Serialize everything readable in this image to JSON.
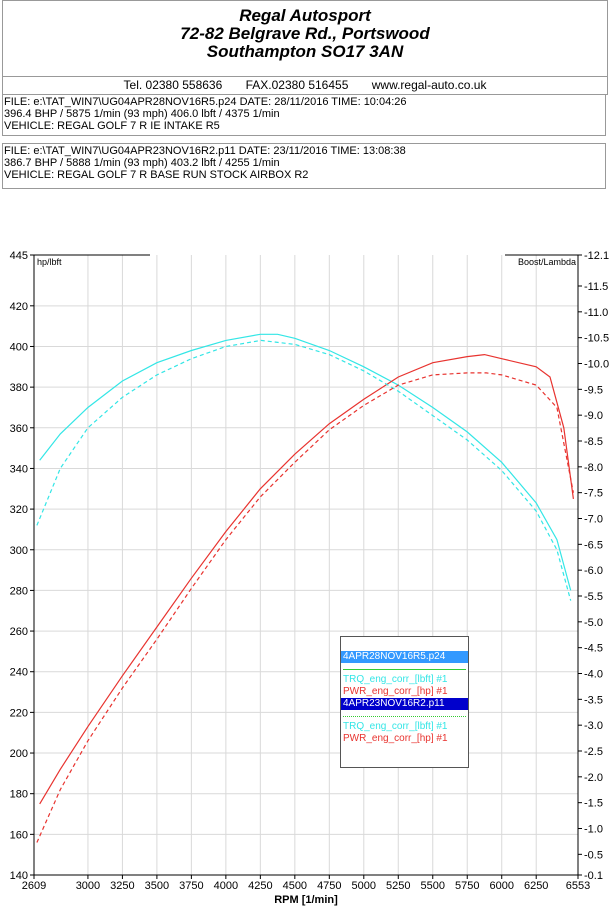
{
  "header": {
    "line1": "Regal Autosport",
    "line2": "72-82 Belgrave Rd., Portswood",
    "line3": "Southampton SO17 3AN",
    "tel": "Tel. 02380 558636",
    "fax": "FAX.02380 516455",
    "web": "www.regal-auto.co.uk"
  },
  "file1": {
    "line1": "FILE: e:\\TAT_WIN7\\UG04APR28NOV16R5.p24  DATE: 28/11/2016  TIME: 10:04:26",
    "line2": "396.4 BHP / 5875 1/min (93 mph)    406.0 lbft / 4375 1/min",
    "line3": "VEHICLE: REGAL GOLF 7 R IE INTAKE R5"
  },
  "file2": {
    "line1": "FILE: e:\\TAT_WIN7\\UG04APR23NOV16R2.p11  DATE: 23/11/2016  TIME: 13:08:38",
    "line2": "386.7 BHP / 5888 1/min (93 mph)    403.2 lbft / 4255 1/min",
    "line3": "VEHICLE: REGAL GOLF 7 R BASE RUN STOCK AIRBOX R2"
  },
  "legend": {
    "run1": "4APR28NOV16R5.p24",
    "trq1": "TRQ_eng_corr_[lbft] #1",
    "pwr1": "PWR_eng_corr_[hp] #1",
    "run2": "4APR23NOV16R2.p11",
    "trq2": "TRQ_eng_corr_[lbft] #1",
    "pwr2": "PWR_eng_corr_[hp] #1"
  },
  "chart_data": {
    "type": "line",
    "xlabel": "RPM  [1/min]",
    "ylabel_left": "hp/lbft",
    "ylabel_right": "Boost/Lambda",
    "xlim": [
      2609,
      6553
    ],
    "ylim": [
      140,
      445
    ],
    "ylim_right": [
      0.1,
      12.1
    ],
    "x_ticks": [
      2609,
      3000,
      3250,
      3500,
      3750,
      4000,
      4250,
      4500,
      4750,
      5000,
      5250,
      5500,
      5750,
      6000,
      6250,
      6553
    ],
    "y_ticks": [
      140,
      160,
      180,
      200,
      220,
      240,
      260,
      280,
      300,
      320,
      340,
      360,
      380,
      400,
      420,
      445
    ],
    "y_right_ticks": [
      "0.1",
      "0.5",
      "1.0",
      "1.5",
      "2.0",
      "2.5",
      "3.0",
      "3.5",
      "4.0",
      "4.5",
      "5.0",
      "5.5",
      "6.0",
      "6.5",
      "7.0",
      "7.5",
      "8.0",
      "8.5",
      "9.0",
      "9.5",
      "10.0",
      "10.5",
      "11.0",
      "11.5",
      "12.1"
    ],
    "grid": true,
    "colors": {
      "torque": "#33e6e6",
      "power": "#e8332f"
    },
    "series": [
      {
        "name": "TRQ_eng_corr_[lbft] #1",
        "run": "4APR28NOV16R5.p24",
        "color": "#33e6e6",
        "dash": false,
        "x": [
          2650,
          2800,
          3000,
          3250,
          3500,
          3750,
          4000,
          4250,
          4375,
          4500,
          4750,
          5000,
          5250,
          5500,
          5750,
          6000,
          6250,
          6400,
          6500
        ],
        "y": [
          344,
          357,
          370,
          383,
          392,
          398,
          403,
          406,
          406,
          404,
          398,
          390,
          381,
          370,
          358,
          343,
          323,
          305,
          280
        ]
      },
      {
        "name": "PWR_eng_corr_[hp] #1",
        "run": "4APR28NOV16R5.p24",
        "color": "#e8332f",
        "dash": false,
        "x": [
          2650,
          2800,
          3000,
          3250,
          3500,
          3750,
          4000,
          4250,
          4500,
          4750,
          5000,
          5250,
          5500,
          5750,
          5875,
          6000,
          6250,
          6350,
          6450,
          6520
        ],
        "y": [
          175,
          192,
          213,
          238,
          262,
          286,
          309,
          330,
          347,
          362,
          374,
          385,
          392,
          395,
          396,
          394,
          390,
          385,
          360,
          325
        ]
      },
      {
        "name": "TRQ_eng_corr_[lbft] #1",
        "run": "4APR23NOV16R2.p11",
        "color": "#33e6e6",
        "dash": true,
        "x": [
          2630,
          2800,
          3000,
          3250,
          3500,
          3750,
          4000,
          4255,
          4500,
          4750,
          5000,
          5250,
          5500,
          5750,
          6000,
          6250,
          6400,
          6500
        ],
        "y": [
          312,
          340,
          360,
          375,
          386,
          394,
          400,
          403,
          401,
          396,
          388,
          378,
          366,
          354,
          339,
          319,
          300,
          275
        ]
      },
      {
        "name": "PWR_eng_corr_[hp] #1",
        "run": "4APR23NOV16R2.p11",
        "color": "#e8332f",
        "dash": true,
        "x": [
          2630,
          2800,
          3000,
          3250,
          3500,
          3750,
          4000,
          4250,
          4500,
          4750,
          5000,
          5250,
          5500,
          5750,
          5888,
          6000,
          6250,
          6400,
          6520
        ],
        "y": [
          156,
          182,
          206,
          232,
          256,
          281,
          305,
          326,
          343,
          359,
          371,
          381,
          386,
          387,
          387,
          386,
          381,
          370,
          328
        ]
      }
    ]
  }
}
